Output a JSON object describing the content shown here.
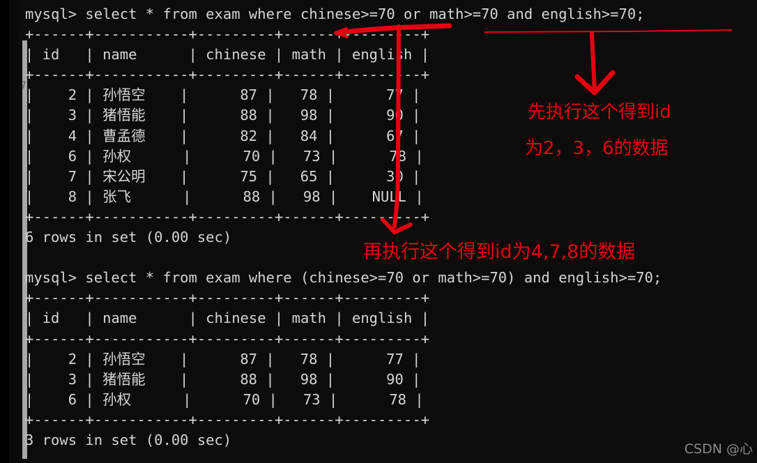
{
  "terminal": {
    "prompt": "mysql>",
    "background_color": "#0c0c0c",
    "text_color": "#d6d6d6",
    "lines": [
      "mysql> select * from exam where chinese>=70 or math>=70 and english>=70;",
      "+------+-----------+---------+------+---------+",
      "| id   | name      | chinese | math | english |",
      "+------+-----------+---------+------+---------+",
      "|    2 | 孙悟空    |      87 |   78 |      77 |",
      "|    3 | 猪悟能    |      88 |   98 |      90 |",
      "|    4 | 曹孟德    |      82 |   84 |      67 |",
      "|    6 | 孙权      |      70 |   73 |      78 |",
      "|    7 | 宋公明    |      75 |   65 |      30 |",
      "|    8 | 张飞      |      88 |   98 |    NULL |",
      "+------+-----------+---------+------+---------+",
      "6 rows in set (0.00 sec)",
      "",
      "mysql> select * from exam where (chinese>=70 or math>=70) and english>=70;",
      "+------+-----------+---------+------+---------+",
      "| id   | name      | chinese | math | english |",
      "+------+-----------+---------+------+---------+",
      "|    2 | 孙悟空    |      87 |   78 |      77 |",
      "|    3 | 猪悟能    |      88 |   98 |      90 |",
      "|    6 | 孙权      |      70 |   73 |      78 |",
      "+------+-----------+---------+------+---------+",
      "3 rows in set (0.00 sec)"
    ],
    "query1": "select * from exam where chinese>=70 or math>=70 and english>=70;",
    "query2": "select * from exam where (chinese>=70 or math>=70) and english>=70;",
    "result1": {
      "columns": [
        "id",
        "name",
        "chinese",
        "math",
        "english"
      ],
      "rows": [
        [
          "2",
          "孙悟空",
          "87",
          "78",
          "77"
        ],
        [
          "3",
          "猪悟能",
          "88",
          "98",
          "90"
        ],
        [
          "4",
          "曹孟德",
          "82",
          "84",
          "67"
        ],
        [
          "6",
          "孙权",
          "70",
          "73",
          "78"
        ],
        [
          "7",
          "宋公明",
          "75",
          "65",
          "30"
        ],
        [
          "8",
          "张飞",
          "88",
          "98",
          "NULL"
        ]
      ],
      "status": "6 rows in set (0.00 sec)"
    },
    "result2": {
      "columns": [
        "id",
        "name",
        "chinese",
        "math",
        "english"
      ],
      "rows": [
        [
          "2",
          "孙悟空",
          "87",
          "78",
          "77"
        ],
        [
          "3",
          "猪悟能",
          "88",
          "98",
          "90"
        ],
        [
          "6",
          "孙权",
          "70",
          "73",
          "78"
        ]
      ],
      "status": "3 rows in set (0.00 sec)"
    }
  },
  "annotations": {
    "color": "#e60012",
    "note1_line1": "先执行这个得到id",
    "note1_line2": "为2，3，6的数据",
    "note2": "再执行这个得到id为4,7,8的数据"
  },
  "scrollbar": {
    "mark_label": "7"
  },
  "watermark": {
    "text": "CSDN @心"
  }
}
